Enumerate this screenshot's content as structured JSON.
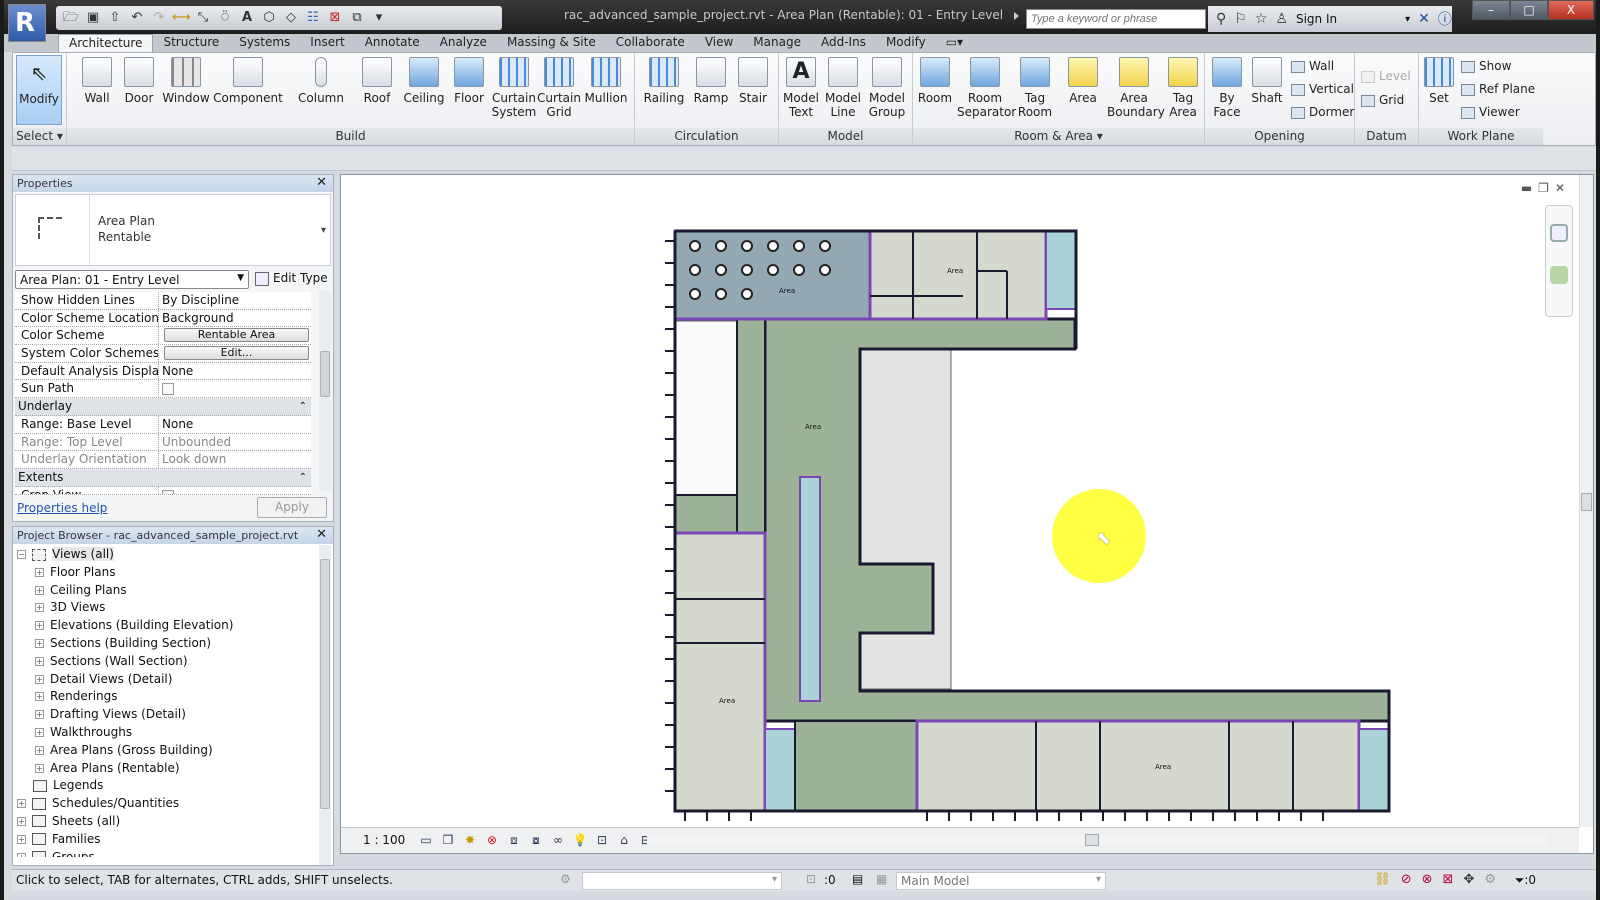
{
  "window": {
    "title": "rac_advanced_sample_project.rvt - Area Plan (Rentable): 01 - Entry Level",
    "app_button": "R",
    "search_placeholder": "Type a keyword or phrase",
    "sign_in": "Sign In",
    "controls": {
      "minimize": "–",
      "maximize": "□",
      "close": "X"
    }
  },
  "quick_access": [
    "open-icon",
    "save-icon",
    "sync-icon",
    "undo-icon",
    "redo-icon",
    "measure-icon",
    "dimension-icon",
    "tag-icon",
    "text-icon",
    "3d-view-icon",
    "section-icon",
    "thin-lines-icon",
    "close-hidden-icon",
    "switch-windows-icon",
    "customize-icon"
  ],
  "tabs": [
    {
      "label": "Architecture",
      "active": true
    },
    {
      "label": "Structure"
    },
    {
      "label": "Systems"
    },
    {
      "label": "Insert"
    },
    {
      "label": "Annotate"
    },
    {
      "label": "Analyze"
    },
    {
      "label": "Massing & Site"
    },
    {
      "label": "Collaborate"
    },
    {
      "label": "View"
    },
    {
      "label": "Manage"
    },
    {
      "label": "Add-Ins"
    },
    {
      "label": "Modify"
    }
  ],
  "ribbon": {
    "panels": {
      "select": "Select ▾",
      "build": "Build",
      "circulation": "Circulation",
      "model": "Model",
      "room_area": "Room & Area ▾",
      "opening": "Opening",
      "datum": "Datum",
      "work_plane": "Work Plane"
    },
    "tools": {
      "modify": "Modify",
      "wall": "Wall",
      "door": "Door",
      "window": "Window",
      "component": "Component",
      "column": "Column",
      "roof": "Roof",
      "ceiling": "Ceiling",
      "floor": "Floor",
      "curtain_system": "Curtain System",
      "curtain_grid": "Curtain Grid",
      "mullion": "Mullion",
      "railing": "Railing",
      "ramp": "Ramp",
      "stair": "Stair",
      "model_text": "Model Text",
      "model_line": "Model Line",
      "model_group": "Model Group",
      "room": "Room",
      "room_separator": "Room Separator",
      "tag_room": "Tag Room",
      "area": "Area",
      "area_boundary": "Area Boundary",
      "tag_area": "Tag Area",
      "by_face": "By Face",
      "shaft": "Shaft",
      "wall_opening": "Wall",
      "vertical": "Vertical",
      "dormer": "Dormer",
      "level": "Level",
      "grid": "Grid",
      "set": "Set",
      "show": "Show",
      "ref_plane": "Ref  Plane",
      "viewer": "Viewer"
    }
  },
  "properties": {
    "title": "Properties",
    "type_name_line1": "Area Plan",
    "type_name_line2": "Rentable",
    "instance_selector": "Area Plan: 01 - Entry Level",
    "edit_type": "Edit Type",
    "rows": [
      {
        "key": "Show Hidden Lines",
        "value": "By Discipline"
      },
      {
        "key": "Color Scheme Location",
        "value": "Background"
      },
      {
        "key": "Color Scheme",
        "button": "Rentable Area"
      },
      {
        "key": "System Color Schemes",
        "button": "Edit..."
      },
      {
        "key": "Default Analysis Display...",
        "value": "None"
      },
      {
        "key": "Sun Path",
        "checkbox": false
      }
    ],
    "underlay_group": "Underlay",
    "underlay_rows": [
      {
        "key": "Range: Base Level",
        "value": "None"
      },
      {
        "key": "Range: Top Level",
        "value": "Unbounded",
        "disabled": true
      },
      {
        "key": "Underlay Orientation",
        "value": "Look down",
        "disabled": true
      }
    ],
    "extents_group": "Extents",
    "extents_rows": [
      {
        "key": "Crop View",
        "checkbox": false
      }
    ],
    "help_link": "Properties help",
    "apply": "Apply"
  },
  "project_browser": {
    "title": "Project Browser - rac_advanced_sample_project.rvt",
    "root": "Views (all)",
    "views": [
      "Floor Plans",
      "Ceiling Plans",
      "3D Views",
      "Elevations (Building Elevation)",
      "Sections (Building Section)",
      "Sections (Wall Section)",
      "Detail Views (Detail)",
      "Renderings",
      "Drafting Views (Detail)",
      "Walkthroughs",
      "Area Plans (Gross Building)",
      "Area Plans (Rentable)"
    ],
    "top_level": [
      "Legends",
      "Schedules/Quantities",
      "Sheets (all)",
      "Families",
      "Groups"
    ]
  },
  "view": {
    "scale": "1 : 100",
    "view_controls": [
      "detail-level-icon",
      "visual-style-icon",
      "sun-path-icon",
      "shadows-icon",
      "crop-view-icon",
      "show-crop-icon",
      "temporary-hide-icon",
      "reveal-hidden-icon",
      "analysis-icon",
      "highlight-icon",
      "worksharing-icon",
      "constraints-icon"
    ],
    "colors": {
      "corridor": "#9db397",
      "dining": "#94a8b4",
      "office": "#d5d8cc",
      "stair": "#a9d3d6",
      "boundary": "#7b47b6",
      "wall": "#1a1a2e",
      "courtyard": "#e4e4e4",
      "highlight": "#ffff33"
    }
  },
  "status": {
    "hint": "Click to select, TAB for alternates, CTRL adds, SHIFT unselects.",
    "worksets_value": "",
    "editable_count": ":0",
    "design_option": "Main Model",
    "filter_count": ":0"
  }
}
